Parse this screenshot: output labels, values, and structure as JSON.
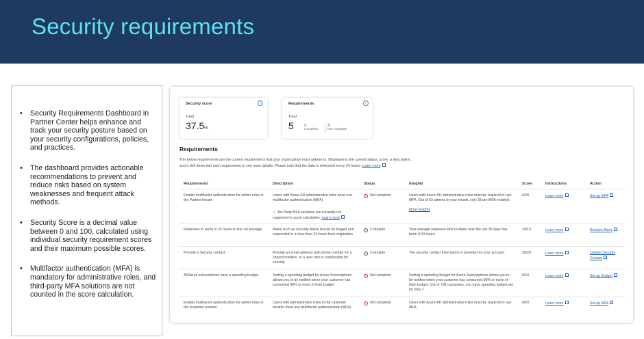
{
  "slide": {
    "title": "Security requirements",
    "bullets": [
      "Security Requirements Dashboard in Partner Center helps enhance and track your security posture based on your security configurations, policies, and practices.",
      "The dashboard provides actionable recommendations to prevent and reduce risks based on system weaknesses and frequent attack methods.",
      "Security Score is a decimal value between 0 and 100, calculated using individual security requirement scores and their maximum possible scores.",
      " Multifactor authentication (MFA) is mandatory for administrative roles, and third-party MFA solutions are not counted in the score calculation."
    ]
  },
  "score_card": {
    "title": "Security score",
    "sub": "Total",
    "value": "37.5",
    "unit": "%"
  },
  "req_card": {
    "title": "Requirements",
    "sub": "Total",
    "total": "5",
    "complete": "2",
    "complete_label": "Complete",
    "not_complete": "3",
    "not_complete_label": "Not complete"
  },
  "requirements": {
    "heading": "Requirements",
    "description": "The below requirements are the current requirements that your organization must adhere to. Displayed is the current status, score, a description, and a drill down into each requirement to see more details. Please note that the data is refreshed every 24 hours.",
    "learn_more": "Learn more",
    "columns": [
      "Requirements",
      "Description",
      "Status",
      "Insights",
      "Score",
      "Instructions",
      "Action"
    ],
    "rows": [
      {
        "requirement": "Enable multifactor authentication for admin roles in the Partner tenant",
        "description": "Users with Azure AD administrative roles must use multifactor authentication (MFA)",
        "note": "3rd Party MFA solutions are currently not supported in score calculation.",
        "note_link": "Learn more",
        "status": "Not complete",
        "status_icon": "error-circle-icon",
        "insights": "Users with Azure AD administrative roles must be required to use MFA. Out of 53 admins in your tenant, only 28 are MFA enabled.",
        "insights_link": "More insights",
        "score": "0/20",
        "instructions": "Learn more",
        "action": "Set up MFA"
      },
      {
        "requirement": "Response to alerts is 24 hours or less on average",
        "description": "Alerts such as Security Alerts should be triaged and responded to in less than 24 hours from origination",
        "status": "Complete",
        "status_icon": "check-circle-icon",
        "insights": "Your average response time to alerts over the last 30 days has been 0.00 hours.",
        "score": "10/10",
        "instructions": "Learn more",
        "action": "Resolve Alerts"
      },
      {
        "requirement": "Provide a Security contact",
        "description": "Provide an email address and phone number for a shared mailbox, or a user who is responsible for security",
        "status": "Complete",
        "status_icon": "check-circle-icon",
        "insights": "The security contact information is provided for your account.",
        "score": "20/20",
        "instructions": "Learn more",
        "action": "Update Security Contact"
      },
      {
        "requirement": "All Azure subscriptions have a spending budget",
        "description": "Setting a spending budget for Azure Subscriptions allows you to be notified when your customer has consumed 80% or more of their budget",
        "status": "Not complete",
        "status_icon": "error-circle-icon",
        "insights": "Setting a spending budget for Azure Subscriptions allows you to be notified when your customer has consumed 80% or more of their budget. Out of 708 customers, you have spending budget set for only 7.",
        "score": "0/10",
        "instructions": "Learn more",
        "action": "Set up Budget"
      },
      {
        "requirement": "Enable multifactor authentication for admin roles in the customer tenants",
        "description": "Users with administrative roles in the customer tenants must use multifactor authentication (MFA)",
        "status": "Not complete",
        "status_icon": "error-circle-icon",
        "insights": "Users with Azure AD administrative roles must be required to use MFA.",
        "score": "0/20",
        "instructions": "Learn more",
        "action": "Set up MFA"
      }
    ]
  }
}
